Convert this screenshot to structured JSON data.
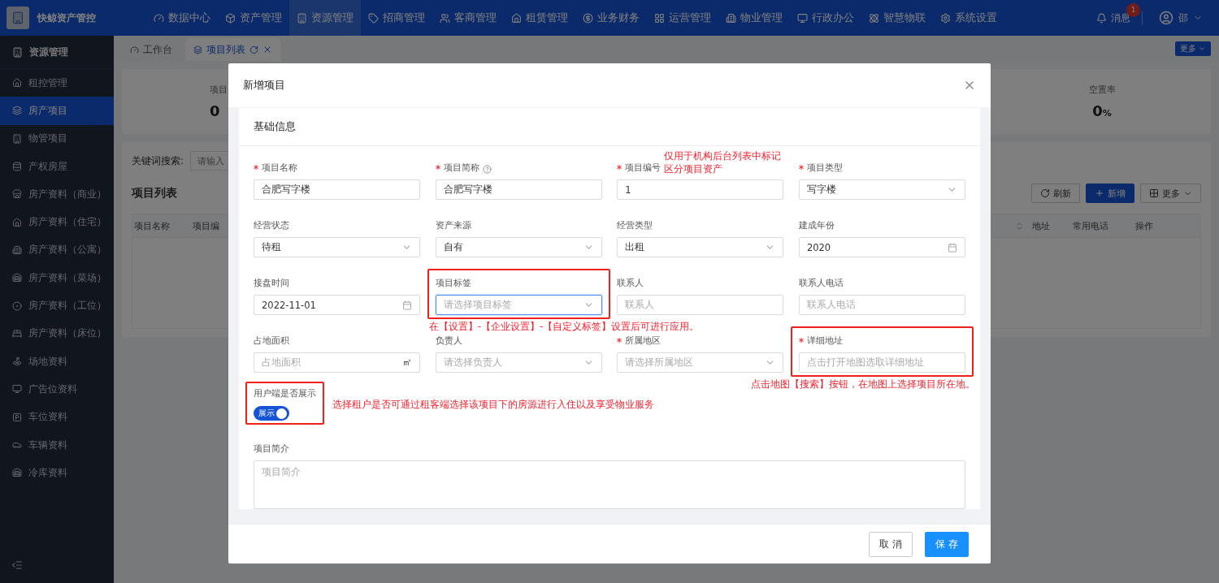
{
  "top_bar": {
    "brand": "快鲸资产管控",
    "nav": [
      {
        "label": "数据中心",
        "selected": false
      },
      {
        "label": "资产管理",
        "selected": false
      },
      {
        "label": "资源管理",
        "selected": true
      },
      {
        "label": "招商管理",
        "selected": false
      },
      {
        "label": "客商管理",
        "selected": false
      },
      {
        "label": "租赁管理",
        "selected": false
      },
      {
        "label": "业务财务",
        "selected": false
      },
      {
        "label": "运营管理",
        "selected": false
      },
      {
        "label": "物业管理",
        "selected": false
      },
      {
        "label": "行政办公",
        "selected": false
      },
      {
        "label": "智慧物联",
        "selected": false
      },
      {
        "label": "系统设置",
        "selected": false
      }
    ],
    "messages": {
      "label": "消息",
      "badge": "1"
    },
    "user": "邵"
  },
  "sidebar": {
    "title": "资源管理",
    "items": [
      {
        "label": "租控管理",
        "selected": false
      },
      {
        "label": "房产项目",
        "selected": true
      },
      {
        "label": "物管项目",
        "selected": false
      },
      {
        "label": "产权房屋",
        "selected": false
      },
      {
        "label": "房产资料（商业）",
        "selected": false
      },
      {
        "label": "房产资料（住宅）",
        "selected": false
      },
      {
        "label": "房产资料（公寓）",
        "selected": false
      },
      {
        "label": "房产资料（菜场）",
        "selected": false
      },
      {
        "label": "房产资料（工位）",
        "selected": false
      },
      {
        "label": "房产资料（床位）",
        "selected": false
      },
      {
        "label": "场地资料",
        "selected": false
      },
      {
        "label": "广告位资料",
        "selected": false
      },
      {
        "label": "车位资料",
        "selected": false
      },
      {
        "label": "车辆资料",
        "selected": false
      },
      {
        "label": "冷库资料",
        "selected": false
      }
    ]
  },
  "tabs": [
    {
      "label": "工作台",
      "selected": false,
      "closable": false
    },
    {
      "label": "项目列表",
      "selected": true,
      "closable": true
    }
  ],
  "more_button": "更多",
  "stats": [
    {
      "label": "项目",
      "value": "0"
    },
    {
      "label": "空置率",
      "value": "0",
      "unit": "%"
    }
  ],
  "search": {
    "label": "关键词搜索:",
    "placeholder": "请输入"
  },
  "list": {
    "title": "项目列表",
    "buttons": [
      {
        "kind": "refresh",
        "label": "刷新"
      },
      {
        "kind": "add",
        "label": "新增"
      },
      {
        "kind": "more",
        "label": "更多"
      }
    ],
    "columns_left": [
      "项目名称",
      "项目编"
    ],
    "columns_right": [
      "地址",
      "常用电话",
      "操作"
    ]
  },
  "dialog": {
    "title": "新增项目",
    "section": "基础信息",
    "fields": [
      {
        "kind": "input",
        "label": "项目名称",
        "required": true,
        "value": "合肥写字楼"
      },
      {
        "kind": "input",
        "label": "项目简称",
        "required": true,
        "help": true,
        "value": "合肥写字楼"
      },
      {
        "kind": "input",
        "label": "项目编号",
        "required": true,
        "value": "1",
        "note": "仅用于机构后台列表中标记区分项目资产"
      },
      {
        "kind": "select",
        "label": "项目类型",
        "required": true,
        "value": "写字楼"
      },
      {
        "kind": "select",
        "label": "经营状态",
        "required": false,
        "value": "待租"
      },
      {
        "kind": "select",
        "label": "资产来源",
        "required": false,
        "value": "自有"
      },
      {
        "kind": "select",
        "label": "经营类型",
        "required": false,
        "value": "出租"
      },
      {
        "kind": "date",
        "label": "建成年份",
        "required": false,
        "value": "2020"
      },
      {
        "kind": "date",
        "label": "接盘时间",
        "required": false,
        "value": "2022-11-01"
      },
      {
        "kind": "select",
        "label": "项目标签",
        "required": false,
        "placeholder": "请选择项目标签",
        "focused": true,
        "framed": true,
        "note": "在【设置】-【企业设置】-【自定义标签】设置后可进行应用。"
      },
      {
        "kind": "input",
        "label": "联系人",
        "required": false,
        "placeholder": "联系人"
      },
      {
        "kind": "input",
        "label": "联系人电话",
        "required": false,
        "placeholder": "联系人电话"
      },
      {
        "kind": "unit",
        "label": "占地面积",
        "required": false,
        "placeholder": "占地面积",
        "unit": "㎡"
      },
      {
        "kind": "select",
        "label": "负责人",
        "required": false,
        "placeholder": "请选择负责人"
      },
      {
        "kind": "select",
        "label": "所属地区",
        "required": true,
        "placeholder": "请选择所属地区"
      },
      {
        "kind": "input",
        "label": "详细地址",
        "required": true,
        "placeholder": "点击打开地图选取详细地址",
        "framed": true,
        "note": "点击地图【搜索】按钮，在地图上选择项目所在地。"
      }
    ],
    "toggle": {
      "label": "用户端是否展示",
      "on": true,
      "text": "展示",
      "framed": true,
      "note": "选择租户是否可通过租客端选择该项目下的房源进行入住以及享受物业服务"
    },
    "intro": {
      "label": "项目简介",
      "placeholder": "项目简介"
    },
    "buttons": [
      {
        "kind": "cancel",
        "label": "取 消"
      },
      {
        "kind": "primary",
        "label": "保 存"
      }
    ]
  }
}
